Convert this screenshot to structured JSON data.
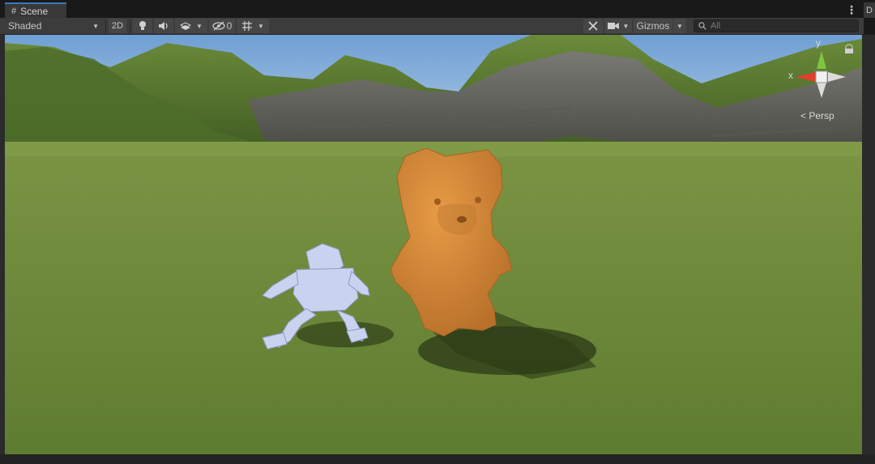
{
  "tabs": {
    "scene_label": "Scene",
    "right_tab_label": "D"
  },
  "toolbar": {
    "draw_mode": "Shaded",
    "mode_2d": "2D",
    "hidden_count": "0",
    "gizmos_label": "Gizmos",
    "search_placeholder": "All"
  },
  "gizmo": {
    "x_label": "x",
    "y_label": "y",
    "projection_label": "< Persp"
  },
  "colors": {
    "sky": "#8fb4dc",
    "grass": "#6f8a3a",
    "bear": "#d48a36",
    "figure": "#c9d3f0",
    "tab_accent": "#3a79bb"
  },
  "icons": [
    "grid-icon",
    "kebab-icon",
    "lightbulb-icon",
    "audio-icon",
    "effects-icon",
    "visibility-icon",
    "grid-snap-icon",
    "tools-icon",
    "camera-icon",
    "search-icon"
  ]
}
